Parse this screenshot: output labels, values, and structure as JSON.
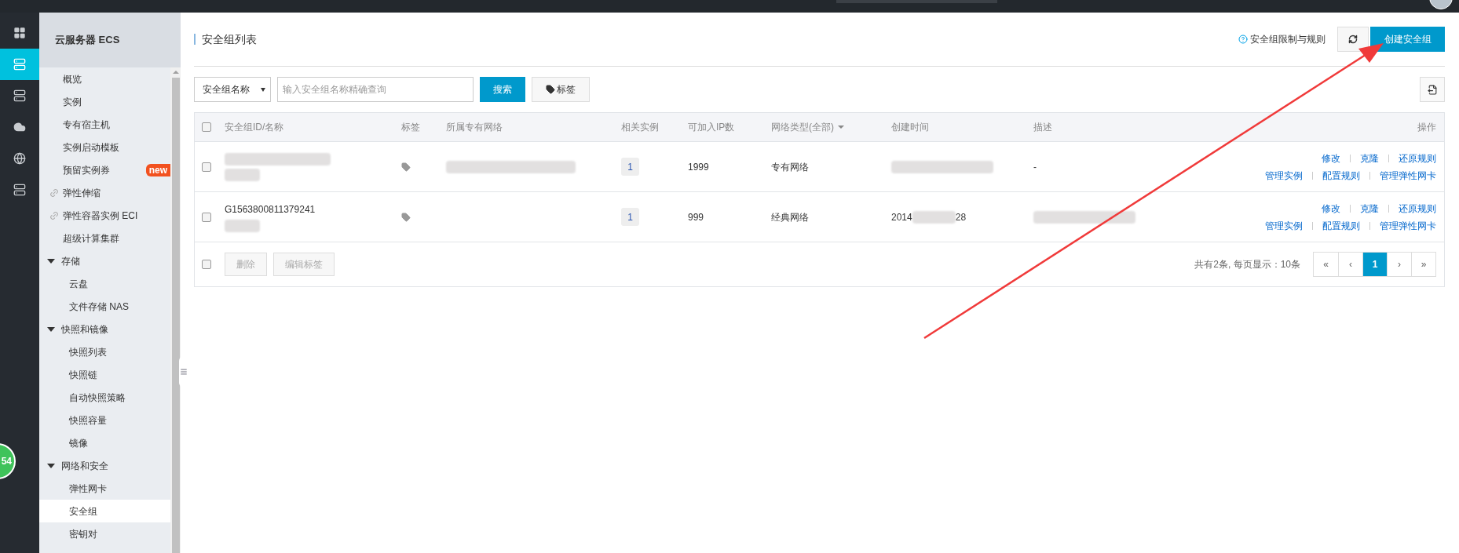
{
  "rail": {
    "items": [
      {
        "kind": "grid",
        "selected": false
      },
      {
        "kind": "server",
        "selected": true
      },
      {
        "kind": "stack",
        "selected": false
      },
      {
        "kind": "cloud",
        "selected": false
      },
      {
        "kind": "globe",
        "selected": false
      },
      {
        "kind": "stack",
        "selected": false
      }
    ],
    "float_badge": "54"
  },
  "sidebar": {
    "title": "云服务器 ECS",
    "items": [
      {
        "kind": "item",
        "label": "概览",
        "selected": false
      },
      {
        "kind": "item",
        "label": "实例",
        "selected": false
      },
      {
        "kind": "item",
        "label": "专有宿主机",
        "selected": false
      },
      {
        "kind": "item",
        "label": "实例启动模板",
        "selected": false
      },
      {
        "kind": "item",
        "label": "预留实例券",
        "selected": false,
        "badge": "new"
      },
      {
        "kind": "link",
        "label": "弹性伸缩",
        "selected": false
      },
      {
        "kind": "link",
        "label": "弹性容器实例 ECI",
        "selected": false
      },
      {
        "kind": "item",
        "label": "超级计算集群",
        "selected": false
      },
      {
        "kind": "group",
        "label": "存储",
        "expanded": true,
        "children": [
          {
            "label": "云盘",
            "selected": false
          },
          {
            "label": "文件存储 NAS",
            "selected": false
          }
        ]
      },
      {
        "kind": "group",
        "label": "快照和镜像",
        "expanded": true,
        "children": [
          {
            "label": "快照列表",
            "selected": false
          },
          {
            "label": "快照链",
            "selected": false
          },
          {
            "label": "自动快照策略",
            "selected": false
          },
          {
            "label": "快照容量",
            "selected": false
          },
          {
            "label": "镜像",
            "selected": false
          }
        ]
      },
      {
        "kind": "group",
        "label": "网络和安全",
        "expanded": true,
        "children": [
          {
            "label": "弹性网卡",
            "selected": false
          },
          {
            "label": "安全组",
            "selected": true
          },
          {
            "label": "密钥对",
            "selected": false
          }
        ]
      }
    ]
  },
  "header": {
    "title": "安全组列表",
    "help_link": "安全组限制与规则",
    "create_button": "创建安全组"
  },
  "search": {
    "field_select": "安全组名称",
    "placeholder": "输入安全组名称精确查询",
    "search_button": "搜索",
    "tag_button": "标签"
  },
  "table": {
    "header_checked": false,
    "columns": [
      "安全组ID/名称",
      "标签",
      "所属专有网络",
      "相关实例",
      "可加入IP数",
      "网络类型(全部)",
      "创建时间",
      "描述",
      "操作"
    ],
    "rows": [
      {
        "checked": false,
        "id": {
          "blurred": true
        },
        "name": {
          "blurred": true
        },
        "vpc": {
          "blurred": true
        },
        "instances": "1",
        "ip_count": "1999",
        "network_type": "专有网络",
        "created": {
          "blurred": true
        },
        "description": "-",
        "actions": [
          [
            "修改",
            "克隆",
            "还原规则"
          ],
          [
            "管理实例",
            "配置规则",
            "管理弹性网卡"
          ]
        ]
      },
      {
        "checked": false,
        "id": "G1563800811379241",
        "name": {
          "blurred": true
        },
        "instances": "1",
        "ip_count": "999",
        "network_type": "经典网络",
        "created": {
          "blurred": true,
          "start": "2014",
          "end": "28"
        },
        "description": {
          "blurred": true
        },
        "actions": [
          [
            "修改",
            "克隆",
            "还原规则"
          ],
          [
            "管理实例",
            "配置规则",
            "管理弹性网卡"
          ]
        ]
      }
    ],
    "footer": {
      "checked": false,
      "buttons": [
        {
          "label": "删除",
          "disabled": true
        },
        {
          "label": "编辑标签",
          "disabled": true
        }
      ],
      "summary": "共有2条, 每页显示：10条"
    },
    "pager": [
      {
        "label": "«",
        "selected": false
      },
      {
        "label": "‹",
        "selected": false
      },
      {
        "label": "1",
        "selected": true
      },
      {
        "label": "›",
        "selected": false
      },
      {
        "label": "»",
        "selected": false
      }
    ]
  }
}
